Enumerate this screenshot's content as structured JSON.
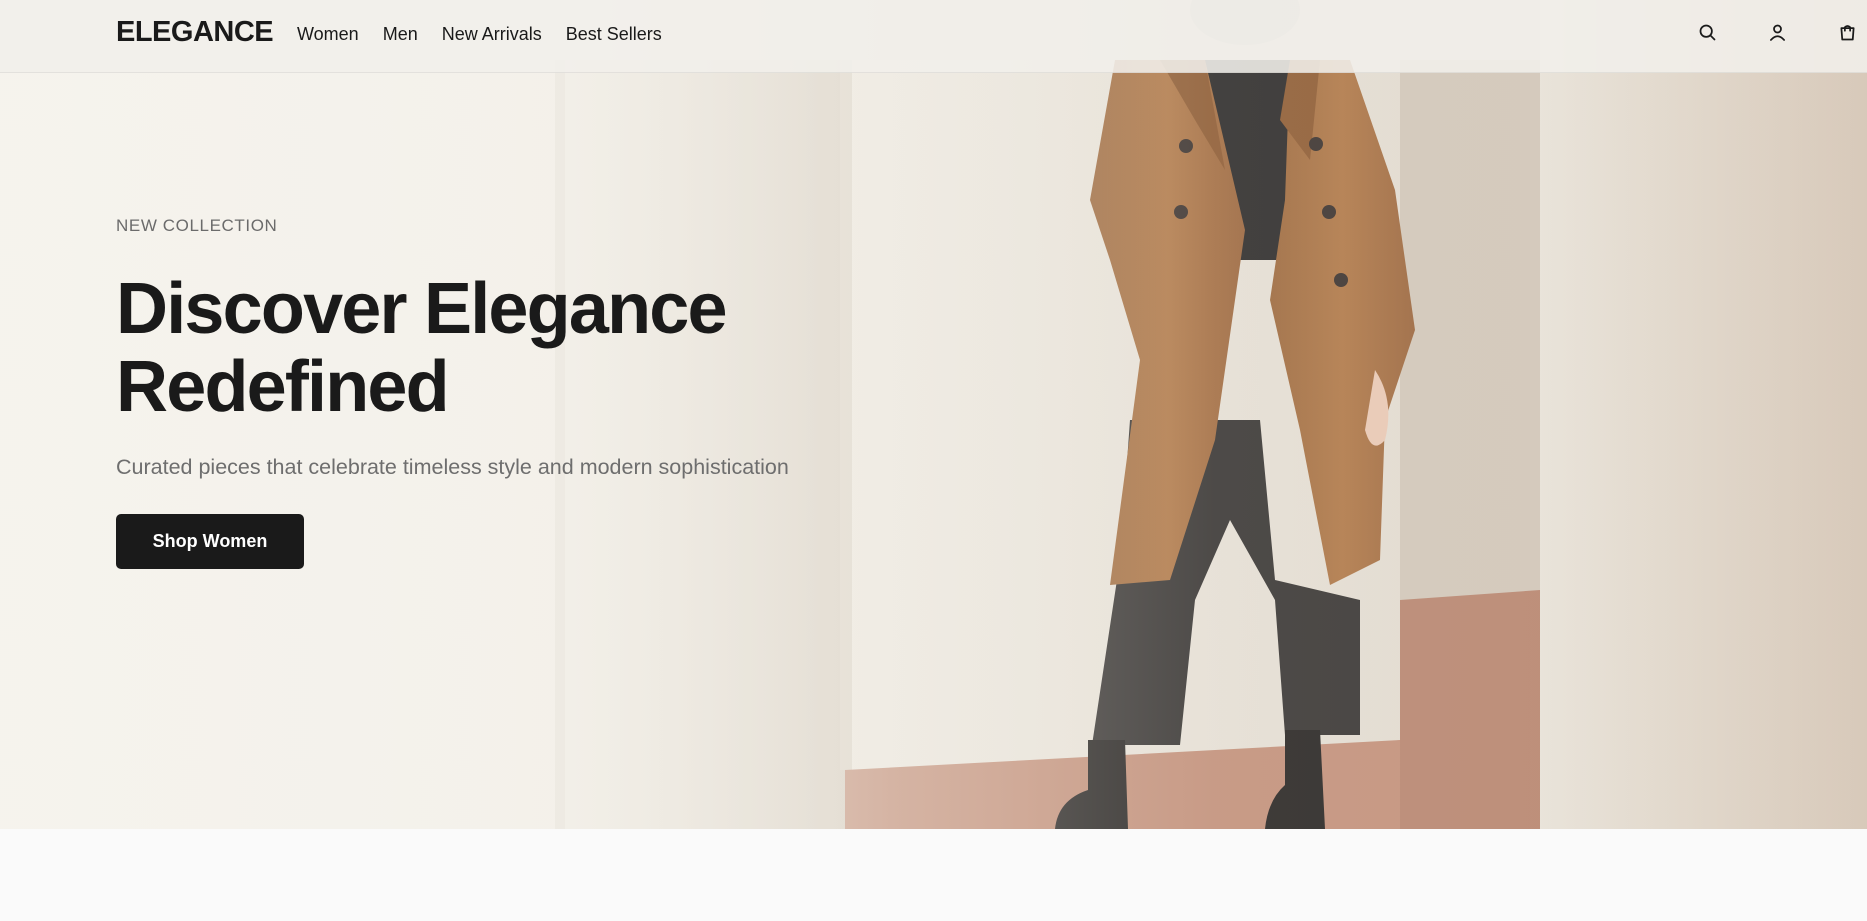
{
  "brand": {
    "logo": "ELEGANCE"
  },
  "nav": {
    "items": [
      {
        "label": "Women"
      },
      {
        "label": "Men"
      },
      {
        "label": "New Arrivals"
      },
      {
        "label": "Best Sellers"
      }
    ]
  },
  "header_icons": {
    "search": "search-icon",
    "account": "user-icon",
    "cart": "shopping-bag-icon"
  },
  "hero": {
    "eyebrow": "NEW COLLECTION",
    "title_line1": "Discover Elegance",
    "title_line2": "Redefined",
    "subtitle": "Curated pieces that celebrate timeless style and modern sophistication",
    "cta_label": "Shop Women"
  },
  "colors": {
    "text_primary": "#1a1a1a",
    "text_muted": "#6e6e6e",
    "cta_background": "#1a1a1a",
    "cta_text": "#ffffff",
    "coat": "#a8703f",
    "floor": "#c08a72",
    "wall": "#e3ddd2"
  }
}
